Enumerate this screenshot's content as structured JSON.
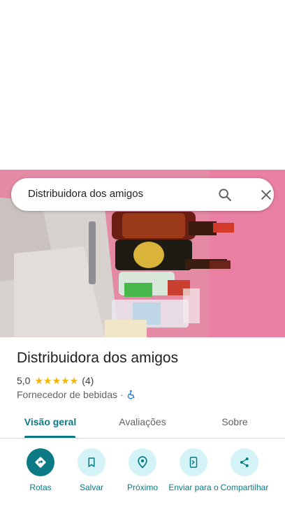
{
  "search": {
    "query": "Distribuidora dos amigos"
  },
  "place": {
    "name": "Distribuidora dos amigos",
    "rating": "5,0",
    "stars": "★★★★★",
    "review_count": "(4)",
    "category": "Fornecedor de bebidas",
    "separator": "·"
  },
  "tabs": [
    {
      "label": "Visão geral",
      "active": true
    },
    {
      "label": "Avaliações",
      "active": false
    },
    {
      "label": "Sobre",
      "active": false
    }
  ],
  "actions": [
    {
      "label": "Rotas",
      "icon": "directions-icon"
    },
    {
      "label": "Salvar",
      "icon": "bookmark-icon"
    },
    {
      "label": "Próximo",
      "icon": "nearby-icon"
    },
    {
      "label": "Enviar para o",
      "icon": "send-to-phone-icon"
    },
    {
      "label": "Compartilhar",
      "icon": "share-icon"
    }
  ],
  "colors": {
    "accent": "#0b7a84",
    "action_bg": "#d3f3f7",
    "star": "#f5b400",
    "accessible": "#1a73e8"
  }
}
